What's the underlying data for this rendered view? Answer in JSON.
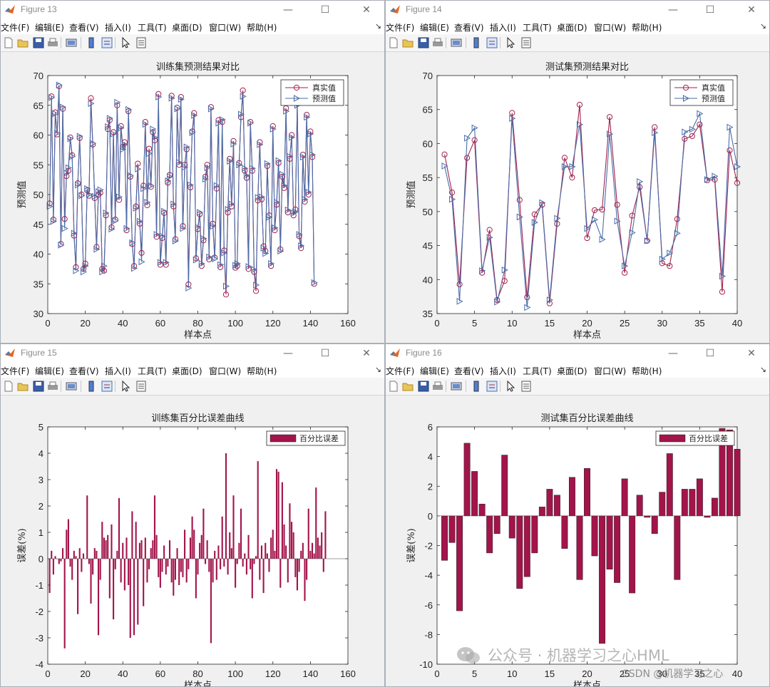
{
  "menu": [
    "文件(F)",
    "编辑(E)",
    "查看(V)",
    "插入(I)",
    "工具(T)",
    "桌面(D)",
    "窗口(W)",
    "帮助(H)"
  ],
  "window_controls": {
    "minimize": "—",
    "maximize": "☐",
    "close": "✕"
  },
  "toolbar_icons": [
    "new-icon",
    "open-icon",
    "save-icon",
    "print-icon",
    "link-icon",
    "colorbar-icon",
    "legend-icon",
    "pointer-icon",
    "property-icon"
  ],
  "colors": {
    "true_series": "#a2224e",
    "pred_series": "#4a6ea9",
    "bar": "#a2144a"
  },
  "watermark": {
    "text": "公众号 · 机器学习之心HML",
    "csdn": "CSDN @机器学习之心"
  },
  "windows": [
    {
      "title": "Figure 13",
      "chart_data": {
        "type": "line",
        "title": "训练集预测结果对比",
        "xlabel": "样本点",
        "ylabel": "预测值",
        "xlim": [
          0,
          160
        ],
        "ylim": [
          30,
          70
        ],
        "xticks": [
          0,
          20,
          40,
          60,
          80,
          100,
          120,
          140,
          160
        ],
        "yticks": [
          30,
          35,
          40,
          45,
          50,
          55,
          60,
          65,
          70
        ],
        "legend_position": "top-right",
        "series": [
          {
            "name": "真实值",
            "marker": "circle",
            "values": [
              48.5,
              66.5,
              45.8,
              63.8,
              60.1,
              68.2,
              41.7,
              64.4,
              45.9,
              53.1,
              54.0,
              59.6,
              56.6,
              43.1,
              37.8,
              51.9,
              59.5,
              50.0,
              37.5,
              38.4,
              50.7,
              49.8,
              66.2,
              58.4,
              49.4,
              41.2,
              50.0,
              50.3,
              37.5,
              37.2,
              46.5,
              61.0,
              62.5,
              44.5,
              60.5,
              45.8,
              65.0,
              49.1,
              61.5,
              58.0,
              58.8,
              44.0,
              64.0,
              53.0,
              41.7,
              38.0,
              48.0,
              55.2,
              45.1,
              40.2,
              51.5,
              62.2,
              48.2,
              57.7,
              51.3,
              60.5,
              59.1,
              42.9,
              66.9,
              38.2,
              42.7,
              46.9,
              38.2,
              52.0,
              53.3,
              66.6,
              48.0,
              42.5,
              64.6,
              55.0,
              66.4,
              44.7,
              55.0,
              57.6,
              34.9,
              51.2,
              60.6,
              63.7,
              39.3,
              44.2,
              46.7,
              38.0,
              42.3,
              53.0,
              55.0,
              39.1,
              64.7,
              45.1,
              39.4,
              51.0,
              62.5,
              37.8,
              62.2,
              40.6,
              33.2,
              47.0,
              56.0,
              48.0,
              59.0,
              37.7,
              38.0,
              55.3,
              63.0,
              67.5,
              54.0,
              52.8,
              37.5,
              62.2,
              54.0,
              37.0,
              33.8,
              49.0,
              58.8,
              49.2,
              41.3,
              40.5,
              54.8,
              46.5,
              38.0,
              61.5,
              44.0,
              48.3,
              55.3,
              40.8,
              53.0,
              51.1,
              64.5,
              47.0,
              56.0,
              60.0,
              46.5,
              47.5,
              65.3,
              43.0,
              41.0,
              56.7,
              48.8,
              63.4,
              50.0,
              60.6,
              56.3,
              35.0
            ],
            "color": "#a2224e"
          },
          {
            "name": "预测值",
            "marker": "triangle",
            "values": [
              48.0,
              66.3,
              45.5,
              63.6,
              60.3,
              68.4,
              41.5,
              64.7,
              44.3,
              53.6,
              54.5,
              59.4,
              56.4,
              43.5,
              37.2,
              51.6,
              59.8,
              49.8,
              37.0,
              38.0,
              51.0,
              50.0,
              65.3,
              58.6,
              49.7,
              40.8,
              50.5,
              50.8,
              37.0,
              38.0,
              46.9,
              61.4,
              62.8,
              44.2,
              60.2,
              45.6,
              65.5,
              49.6,
              61.2,
              57.6,
              58.4,
              44.3,
              64.3,
              53.2,
              41.9,
              37.6,
              47.7,
              54.3,
              45.5,
              38.7,
              51.0,
              61.8,
              48.7,
              56.9,
              51.5,
              61.0,
              59.6,
              43.3,
              66.4,
              38.6,
              43.0,
              47.2,
              38.6,
              52.3,
              53.0,
              66.2,
              48.4,
              42.2,
              64.4,
              55.4,
              66.0,
              44.3,
              54.6,
              58.0,
              34.3,
              51.6,
              60.4,
              63.3,
              39.0,
              44.5,
              47.0,
              38.4,
              42.6,
              52.6,
              54.5,
              39.5,
              64.4,
              44.7,
              39.2,
              51.5,
              62.0,
              38.2,
              62.6,
              40.2,
              34.6,
              47.5,
              55.6,
              48.4,
              58.5,
              38.1,
              38.4,
              55.0,
              63.5,
              66.5,
              54.4,
              53.2,
              37.9,
              62.0,
              54.4,
              37.4,
              34.8,
              49.5,
              58.4,
              49.6,
              41.0,
              40.1,
              55.2,
              46.2,
              38.4,
              61.0,
              44.4,
              48.7,
              55.7,
              40.5,
              53.4,
              51.5,
              64.0,
              47.4,
              56.4,
              59.6,
              46.9,
              47.1,
              65.0,
              43.3,
              41.4,
              56.3,
              49.2,
              63.0,
              50.4,
              60.2,
              56.7,
              35.2
            ],
            "color": "#4a6ea9"
          }
        ]
      }
    },
    {
      "title": "Figure 14",
      "chart_data": {
        "type": "line",
        "title": "测试集预测结果对比",
        "xlabel": "样本点",
        "ylabel": "预测值",
        "xlim": [
          0,
          40
        ],
        "ylim": [
          35,
          70
        ],
        "xticks": [
          0,
          5,
          10,
          15,
          20,
          25,
          30,
          35,
          40
        ],
        "yticks": [
          35,
          40,
          45,
          50,
          55,
          60,
          65,
          70
        ],
        "legend_position": "top-right",
        "series": [
          {
            "name": "真实值",
            "marker": "circle",
            "x": [
              1,
              2,
              3,
              4,
              5,
              6,
              7,
              8,
              9,
              10,
              11,
              12,
              13,
              14,
              15,
              16,
              17,
              18,
              19,
              20,
              21,
              22,
              23,
              24,
              25,
              26,
              27,
              28,
              29,
              30,
              31,
              32,
              33,
              34,
              35,
              36,
              37,
              38,
              39,
              40
            ],
            "values": [
              58.4,
              52.8,
              39.3,
              57.9,
              60.5,
              41.0,
              47.3,
              37.0,
              39.8,
              64.5,
              51.7,
              37.4,
              49.6,
              51.0,
              36.5,
              48.2,
              57.9,
              55.0,
              65.7,
              46.1,
              50.2,
              50.3,
              63.9,
              51.0,
              41.0,
              49.4,
              53.6,
              45.7,
              62.4,
              42.4,
              42.0,
              48.9,
              60.7,
              61.1,
              62.8,
              54.6,
              54.7,
              38.2,
              59.0,
              54.2
            ],
            "color": "#a2224e"
          },
          {
            "name": "预测值",
            "marker": "triangle",
            "x": [
              1,
              2,
              3,
              4,
              5,
              6,
              7,
              8,
              9,
              10,
              11,
              12,
              13,
              14,
              15,
              16,
              17,
              18,
              19,
              20,
              21,
              22,
              23,
              24,
              25,
              26,
              27,
              28,
              29,
              30,
              31,
              32,
              33,
              34,
              35,
              36,
              37,
              38,
              39,
              40
            ],
            "values": [
              56.7,
              51.8,
              36.8,
              60.8,
              62.3,
              41.3,
              46.2,
              36.7,
              41.4,
              63.7,
              49.2,
              35.9,
              48.4,
              51.3,
              37.0,
              49.0,
              56.6,
              56.6,
              62.8,
              47.5,
              48.8,
              45.9,
              61.4,
              48.6,
              42.0,
              46.9,
              54.4,
              45.7,
              61.6,
              43.0,
              43.9,
              46.8,
              61.7,
              62.1,
              64.4,
              54.7,
              55.2,
              40.5,
              62.4,
              56.6
            ],
            "color": "#4a6ea9"
          }
        ]
      }
    },
    {
      "title": "Figure 15",
      "chart_data": {
        "type": "bar",
        "title": "训练集百分比误差曲线",
        "xlabel": "样本点",
        "ylabel": "误差(%)",
        "xlim": [
          0,
          160
        ],
        "ylim": [
          -4,
          5
        ],
        "xticks": [
          0,
          20,
          40,
          60,
          80,
          100,
          120,
          140,
          160
        ],
        "yticks": [
          -4,
          -3,
          -2,
          -1,
          0,
          1,
          2,
          3,
          4,
          5
        ],
        "legend_position": "top-right",
        "series": [
          {
            "name": "百分比误差",
            "values": [
              -1.3,
              0.3,
              -0.6,
              0.1,
              0.0,
              -0.2,
              -0.1,
              0.4,
              -3.4,
              1.1,
              1.5,
              -0.3,
              -0.8,
              0.3,
              0.1,
              -2.1,
              0.4,
              -0.5,
              0.2,
              0.0,
              2.4,
              -0.2,
              -1.7,
              -0.6,
              0.4,
              0.3,
              -2.9,
              -0.8,
              1.4,
              0.8,
              0.7,
              0.9,
              -1.5,
              1.3,
              -2.3,
              -0.4,
              0.3,
              2.3,
              -0.9,
              0.6,
              -1.2,
              0.8,
              -1.0,
              -3.0,
              1.8,
              -2.9,
              1.4,
              -2.5,
              0.6,
              0.7,
              -1.8,
              0.8,
              -0.9,
              -0.4,
              0.4,
              0.7,
              2.4,
              0.9,
              -0.7,
              -1.1,
              -0.5,
              0.5,
              -0.6,
              -0.3,
              0.7,
              -0.9,
              -1.4,
              -0.8,
              0.4,
              -1.0,
              -0.5,
              -0.7,
              1.1,
              -0.9,
              -0.4,
              0.8,
              1.6,
              1.1,
              -1.5,
              -0.6,
              0.6,
              0.9,
              1.9,
              -0.2,
              0.7,
              -0.5,
              -3.2,
              -0.9,
              0.3,
              -0.8,
              0.5,
              -0.4,
              1.6,
              -0.3,
              4.0,
              -0.6,
              1.0,
              0.4,
              2.4,
              -1.1,
              -0.2,
              0.6,
              1.9,
              -0.3,
              0.2,
              -0.6,
              0.9,
              -0.4,
              -1.5,
              -0.2,
              0.1,
              3.7,
              -0.8,
              0.5,
              -1.3,
              0.6,
              0.2,
              -0.5,
              0.8,
              1.1,
              0.3,
              3.4,
              3.3,
              -1.1,
              2.9,
              1.3,
              0.5,
              -0.9,
              2.1,
              1.4,
              1.0,
              -0.7,
              -1.2,
              -0.5,
              0.3,
              0.6,
              -1.6,
              -0.8,
              1.9,
              0.3,
              0.6,
              0.2,
              2.7,
              0.8,
              0.5,
              1.0,
              -0.5,
              1.8
            ],
            "color": "#a2144a"
          }
        ]
      }
    },
    {
      "title": "Figure 16",
      "chart_data": {
        "type": "bar",
        "title": "测试集百分比误差曲线",
        "xlabel": "样本点",
        "ylabel": "误差(%)",
        "xlim": [
          0,
          40
        ],
        "ylim": [
          -10,
          6
        ],
        "xticks": [
          0,
          5,
          10,
          15,
          20,
          25,
          30,
          35,
          40
        ],
        "yticks": [
          -10,
          -8,
          -6,
          -4,
          -2,
          0,
          2,
          4,
          6
        ],
        "legend_position": "top-right",
        "series": [
          {
            "name": "百分比误差",
            "x": [
              1,
              2,
              3,
              4,
              5,
              6,
              7,
              8,
              9,
              10,
              11,
              12,
              13,
              14,
              15,
              16,
              17,
              18,
              19,
              20,
              21,
              22,
              23,
              24,
              25,
              26,
              27,
              28,
              29,
              30,
              31,
              32,
              33,
              34,
              35,
              36,
              37,
              38,
              39,
              40
            ],
            "values": [
              -3.0,
              -1.8,
              -6.4,
              4.9,
              3.0,
              0.8,
              -2.5,
              -1.2,
              4.1,
              -1.5,
              -4.9,
              -4.1,
              -2.5,
              0.6,
              1.8,
              1.4,
              -2.2,
              2.6,
              -4.3,
              3.2,
              -2.7,
              -8.6,
              -3.6,
              -4.5,
              2.5,
              -5.2,
              1.4,
              -0.1,
              -1.2,
              1.6,
              4.2,
              -4.3,
              1.8,
              1.8,
              2.5,
              -0.1,
              1.2,
              5.9,
              5.8,
              4.5
            ],
            "color": "#a2144a"
          }
        ]
      }
    }
  ]
}
